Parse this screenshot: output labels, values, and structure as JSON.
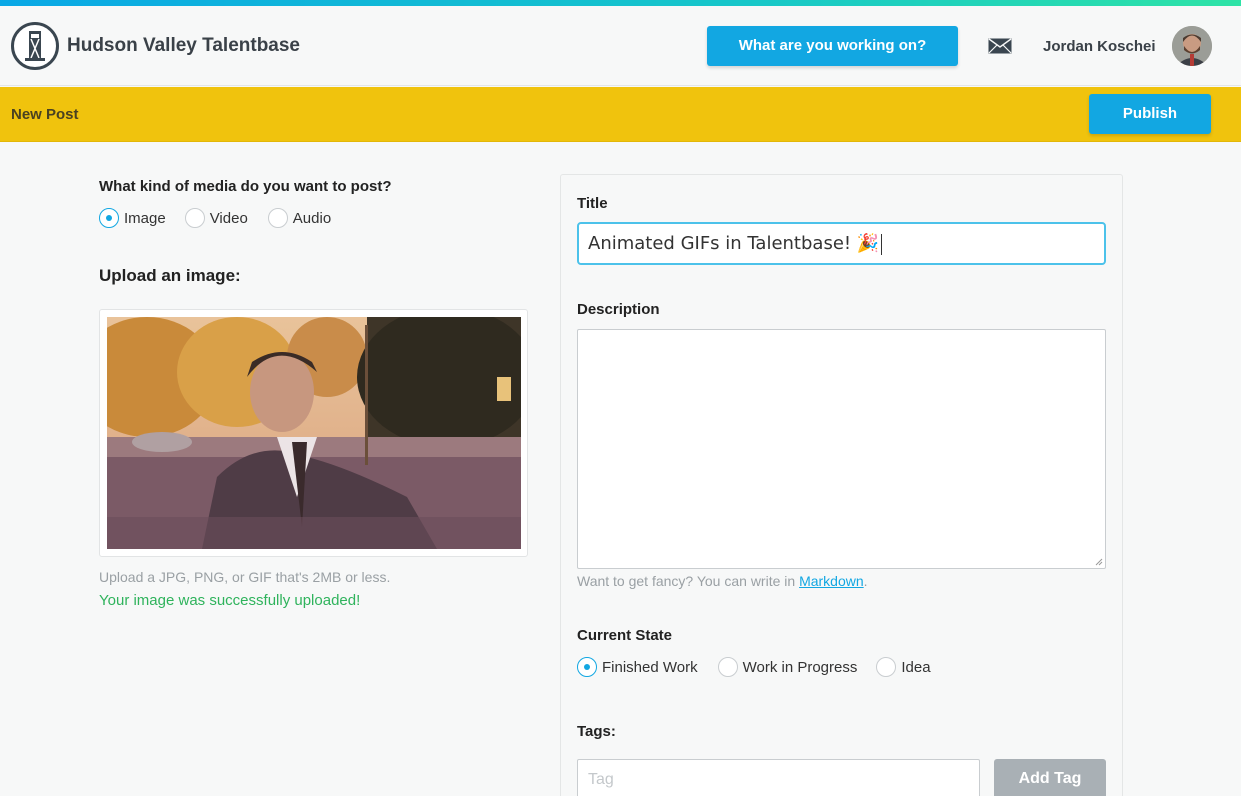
{
  "header": {
    "brand": "Hudson Valley Talentbase",
    "cta_label": "What are you working on?",
    "mail_icon": "envelope-icon",
    "user_name": "Jordan Koschei"
  },
  "subbar": {
    "title": "New Post",
    "publish_label": "Publish"
  },
  "media": {
    "question": "What kind of media do you want to post?",
    "options": [
      "Image",
      "Video",
      "Audio"
    ],
    "selected": "Image",
    "upload_title": "Upload an image:",
    "hint": "Upload a JPG, PNG, or GIF that's 2MB or less.",
    "success": "Your image was successfully uploaded!"
  },
  "form": {
    "title_label": "Title",
    "title_value": "Animated GIFs in Talentbase! 🎉",
    "description_label": "Description",
    "description_value": "",
    "fancy_prefix": "Want to get fancy? You can write in ",
    "fancy_link": "Markdown",
    "fancy_suffix": ".",
    "state_label": "Current State",
    "state_options": [
      "Finished Work",
      "Work in Progress",
      "Idea"
    ],
    "state_selected": "Finished Work",
    "tags_label": "Tags:",
    "tag_placeholder": "Tag",
    "add_tag_label": "Add Tag"
  },
  "colors": {
    "accent": "#12a7e2",
    "subbar": "#f0c30d",
    "success": "#2fb35c"
  }
}
